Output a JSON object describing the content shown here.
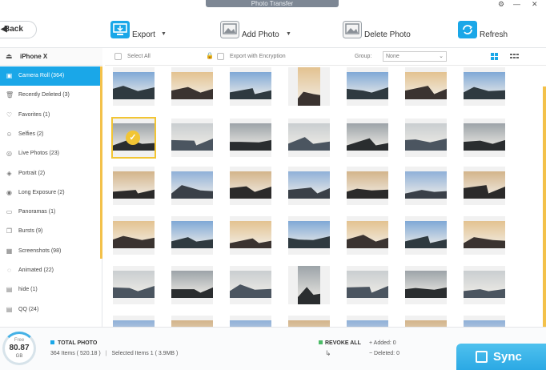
{
  "window": {
    "title": "Photo Transfer"
  },
  "toolbar": {
    "back_label": "Back",
    "export_label": "Export",
    "add_photo_label": "Add Photo",
    "delete_photo_label": "Delete Photo",
    "refresh_label": "Refresh",
    "export_icon": "monitor-export-icon",
    "add_icon": "add-photo-icon",
    "delete_icon": "delete-photo-icon",
    "refresh_icon": "refresh-icon"
  },
  "device": {
    "name": "iPhone X"
  },
  "albums": [
    {
      "label": "Camera Roll (364)",
      "icon": "camera-icon"
    },
    {
      "label": "Recently Deleted (3)",
      "icon": "trash-icon"
    },
    {
      "label": "Favorites (1)",
      "icon": "heart-icon"
    },
    {
      "label": "Selfies (2)",
      "icon": "person-icon"
    },
    {
      "label": "Live Photos (23)",
      "icon": "live-photo-icon"
    },
    {
      "label": "Portrait (2)",
      "icon": "cube-icon"
    },
    {
      "label": "Long Exposure (2)",
      "icon": "aperture-icon"
    },
    {
      "label": "Panoramas (1)",
      "icon": "panorama-icon"
    },
    {
      "label": "Bursts (9)",
      "icon": "bursts-icon"
    },
    {
      "label": "Screenshots (98)",
      "icon": "screenshot-icon"
    },
    {
      "label": "Animated (22)",
      "icon": "animated-icon"
    },
    {
      "label": "hide (1)",
      "icon": "folder-icon"
    },
    {
      "label": "QQ (24)",
      "icon": "folder-icon"
    }
  ],
  "header": {
    "select_all": "Select All",
    "export_encryption": "Export with Encryption",
    "group_label": "Group:",
    "group_value": "None"
  },
  "colors": {
    "accent": "#1aa7e8",
    "selection": "#f2c534",
    "sync": "#2aa8e4"
  },
  "footer": {
    "free_label": "Free",
    "free_value": "80.87",
    "free_unit": "GB",
    "total_label": "TOTAL PHOTO",
    "items": "364 Items ( 520.18 )",
    "selected": "Selected Items 1 ( 3.9MB )",
    "revoke_label": "REVOKE ALL",
    "added": "Added: 0",
    "deleted": "Deleted: 0",
    "sync_label": "Sync"
  }
}
